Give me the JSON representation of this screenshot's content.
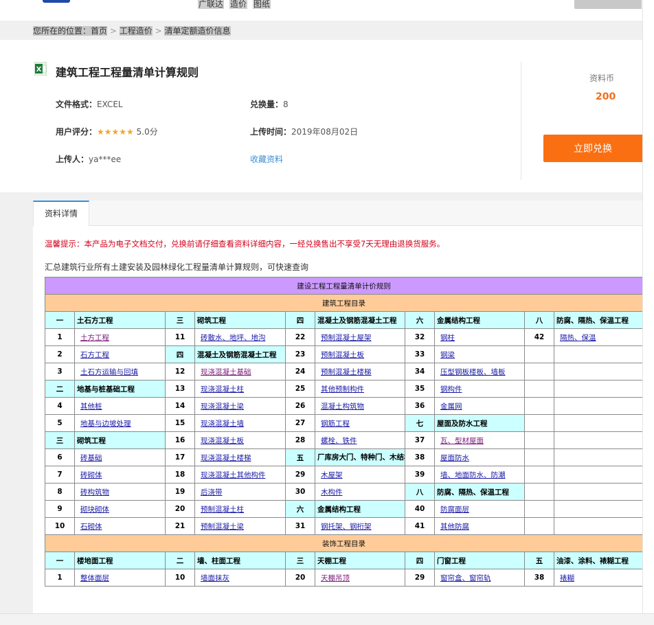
{
  "topnav": [
    "广联达",
    "造价",
    "图纸"
  ],
  "breadcrumb": {
    "prefix": "您所在的位置：",
    "items": [
      "首页",
      "工程造价",
      "清单定额造价信息"
    ],
    "sep": ">"
  },
  "doc": {
    "title": "建筑工程工程量清单计算规则",
    "format_label": "文件格式：",
    "format": "EXCEL",
    "exchange_label": "兑换量：",
    "exchange": "8",
    "rating_label": "用户评分：",
    "stars": "★★★★★",
    "rating": "5.0分",
    "upload_time_label": "上传时间：",
    "upload_time": "2019年08月02日",
    "uploader_label": "上传人：",
    "uploader": "ya***ee",
    "favorite": "收藏资料"
  },
  "coin": {
    "label": "资料币",
    "value": "200",
    "button": "立即兑换"
  },
  "tabs": [
    "资料详情"
  ],
  "warning": "温馨提示：本产品为电子文档交付，兑换前请仔细查看资料详细内容，一经兑换售出不享受7天无理由退换货服务。",
  "intro": "汇总建筑行业所有土建安装及园林绿化工程量清单计算规则，可快速查询",
  "sheet": {
    "title": "建设工程工程量清单计价规则",
    "section1": "建筑工程目录",
    "section2": "装饰工程目录",
    "rows": [
      [
        [
          "一",
          "c"
        ],
        [
          "土石方工程",
          "c"
        ],
        [
          "三",
          "c"
        ],
        [
          "砌筑工程",
          "c"
        ],
        [
          "四",
          "c"
        ],
        [
          "混凝土及钢筋混凝土工程",
          "c"
        ],
        [
          "六",
          "c"
        ],
        [
          "金属结构工程",
          "c"
        ],
        [
          "八",
          "c"
        ],
        [
          "防腐、隔热、保温工程",
          "c"
        ]
      ],
      [
        [
          "1",
          "n"
        ],
        [
          "土方工程",
          "v"
        ],
        [
          "11",
          "n"
        ],
        [
          "砖散水、地坪、地沟",
          "l"
        ],
        [
          "22",
          "n"
        ],
        [
          "预制混凝土屋架",
          "l"
        ],
        [
          "32",
          "n"
        ],
        [
          "钢柱",
          "l"
        ],
        [
          "42",
          "n"
        ],
        [
          "隔热、保温",
          "l"
        ]
      ],
      [
        [
          "2",
          "n"
        ],
        [
          "石方工程",
          "l"
        ],
        [
          "四",
          "c"
        ],
        [
          "混凝土及钢筋混凝土工程",
          "c"
        ],
        [
          "23",
          "n"
        ],
        [
          "预制混凝土板",
          "l"
        ],
        [
          "33",
          "n"
        ],
        [
          "钢梁",
          "l"
        ],
        [
          "",
          "e"
        ],
        [
          "",
          "e"
        ]
      ],
      [
        [
          "3",
          "n"
        ],
        [
          "土石方运输与回填",
          "l"
        ],
        [
          "12",
          "n"
        ],
        [
          "现浇混凝土基础",
          "v"
        ],
        [
          "24",
          "n"
        ],
        [
          "预制混凝土楼梯",
          "l"
        ],
        [
          "34",
          "n"
        ],
        [
          "压型钢板楼板、墙板",
          "l"
        ],
        [
          "",
          "e"
        ],
        [
          "",
          "e"
        ]
      ],
      [
        [
          "二",
          "c"
        ],
        [
          "地基与桩基础工程",
          "c"
        ],
        [
          "13",
          "n"
        ],
        [
          "现浇混凝土柱",
          "l"
        ],
        [
          "25",
          "n"
        ],
        [
          "其他预制构件",
          "l"
        ],
        [
          "35",
          "n"
        ],
        [
          "钢构件",
          "l"
        ],
        [
          "",
          "e"
        ],
        [
          "",
          "e"
        ]
      ],
      [
        [
          "4",
          "n"
        ],
        [
          "其他桩",
          "l"
        ],
        [
          "14",
          "n"
        ],
        [
          "现浇混凝土梁",
          "l"
        ],
        [
          "26",
          "n"
        ],
        [
          "混凝土构筑物",
          "l"
        ],
        [
          "36",
          "n"
        ],
        [
          "金属网",
          "l"
        ],
        [
          "",
          "e"
        ],
        [
          "",
          "e"
        ]
      ],
      [
        [
          "5",
          "n"
        ],
        [
          "地基与边坡处理",
          "l"
        ],
        [
          "15",
          "n"
        ],
        [
          "现浇混凝土墙",
          "l"
        ],
        [
          "27",
          "n"
        ],
        [
          "钢筋工程",
          "l"
        ],
        [
          "七",
          "c"
        ],
        [
          "屋面及防水工程",
          "c"
        ],
        [
          "",
          "e"
        ],
        [
          "",
          "e"
        ]
      ],
      [
        [
          "三",
          "c"
        ],
        [
          "砌筑工程",
          "c"
        ],
        [
          "16",
          "n"
        ],
        [
          "现浇混凝土板",
          "l"
        ],
        [
          "28",
          "n"
        ],
        [
          "螺栓、铁件",
          "l"
        ],
        [
          "37",
          "n"
        ],
        [
          "瓦、型材屋面",
          "v"
        ],
        [
          "",
          "e"
        ],
        [
          "",
          "e"
        ]
      ],
      [
        [
          "6",
          "n"
        ],
        [
          "砖基础",
          "l"
        ],
        [
          "17",
          "n"
        ],
        [
          "现浇混凝土楼梯",
          "l"
        ],
        [
          "五",
          "c"
        ],
        [
          "厂库房大门、特种门、木结构工程",
          "w"
        ],
        [
          "38",
          "n"
        ],
        [
          "屋面防水",
          "l"
        ],
        [
          "",
          "e"
        ],
        [
          "",
          "e"
        ]
      ],
      [
        [
          "7",
          "n"
        ],
        [
          "砖砌体",
          "l"
        ],
        [
          "18",
          "n"
        ],
        [
          "现浇混凝土其他构件",
          "l"
        ],
        [
          "29",
          "n"
        ],
        [
          "木屋架",
          "l"
        ],
        [
          "39",
          "n"
        ],
        [
          "墙、地面防水、防潮",
          "l"
        ],
        [
          "",
          "e"
        ],
        [
          "",
          "e"
        ]
      ],
      [
        [
          "8",
          "n"
        ],
        [
          "砖构筑物",
          "l"
        ],
        [
          "19",
          "n"
        ],
        [
          "后浇带",
          "l"
        ],
        [
          "30",
          "n"
        ],
        [
          "木构件",
          "l"
        ],
        [
          "八",
          "c"
        ],
        [
          "防腐、隔热、保温工程",
          "c"
        ],
        [
          "",
          "e"
        ],
        [
          "",
          "e"
        ]
      ],
      [
        [
          "9",
          "n"
        ],
        [
          "砌块砌体",
          "l"
        ],
        [
          "20",
          "n"
        ],
        [
          "预制混凝土柱",
          "l"
        ],
        [
          "六",
          "c"
        ],
        [
          "金属结构工程",
          "c"
        ],
        [
          "40",
          "n"
        ],
        [
          "防腐面层",
          "l"
        ],
        [
          "",
          "e"
        ],
        [
          "",
          "e"
        ]
      ],
      [
        [
          "10",
          "n"
        ],
        [
          "石砌体",
          "l"
        ],
        [
          "21",
          "n"
        ],
        [
          "预制混凝土梁",
          "l"
        ],
        [
          "31",
          "n"
        ],
        [
          "钢托架、钢桁架",
          "l"
        ],
        [
          "41",
          "n"
        ],
        [
          "其他防腐",
          "l"
        ],
        [
          "",
          "e"
        ],
        [
          "",
          "e"
        ]
      ]
    ],
    "rows2": [
      [
        [
          "一",
          "c"
        ],
        [
          "楼地面工程",
          "c"
        ],
        [
          "二",
          "c"
        ],
        [
          "墙、柱面工程",
          "c"
        ],
        [
          "三",
          "c"
        ],
        [
          "天棚工程",
          "c"
        ],
        [
          "四",
          "c"
        ],
        [
          "门窗工程",
          "c"
        ],
        [
          "五",
          "c"
        ],
        [
          "油漆、涂料、裱糊工程",
          "c"
        ]
      ],
      [
        [
          "1",
          "n"
        ],
        [
          "整体面层",
          "l"
        ],
        [
          "10",
          "n"
        ],
        [
          "墙面抹灰",
          "l"
        ],
        [
          "20",
          "n"
        ],
        [
          "天棚吊顶",
          "v"
        ],
        [
          "29",
          "n"
        ],
        [
          "窗帘盒、窗帘轨",
          "l"
        ],
        [
          "38",
          "n"
        ],
        [
          "裱糊",
          "l"
        ]
      ]
    ]
  }
}
